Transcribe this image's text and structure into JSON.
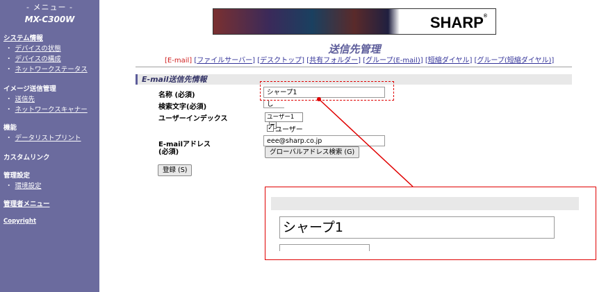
{
  "sidebar": {
    "menu_title": "- メニュー -",
    "model": "MX-C300W",
    "system_info": "システム情報",
    "system_items": [
      "デバイスの状態",
      "デバイスの構成",
      "ネットワークステータス"
    ],
    "image_send": "イメージ送信管理",
    "image_send_items": [
      "送信先",
      "ネットワークスキャナー"
    ],
    "functions": "機能",
    "function_items": [
      "データリストプリント"
    ],
    "custom_link": "カスタムリンク",
    "admin_settings": "管理設定",
    "admin_items": [
      "環境設定"
    ],
    "admin_menu": "管理者メニュー",
    "copyright": "Copyright"
  },
  "banner": {
    "logo": "SHARP",
    "reg": "®"
  },
  "page_title": "送信先管理",
  "tabs": {
    "items": [
      "E-mail",
      "ファイルサーバー",
      "デスクトップ",
      "共有フォルダー",
      "グループ(E-mail)",
      "短縮ダイヤル",
      "グループ(短縮ダイヤル)"
    ],
    "current_index": 0
  },
  "section": {
    "title": "E-mail送信先情報"
  },
  "form": {
    "name_label": "名称 (必須)",
    "name_value": "シャープ1",
    "search_label": "検索文字(必須)",
    "search_value": "し",
    "user_index_label": "ユーザーインデックス",
    "user_index_value": "ユーザー1",
    "user_checkbox_label": "ユーザー",
    "user_checkbox_checked": true,
    "email_label_1": "E-mailアドレス",
    "email_label_2": "(必須)",
    "email_value": "eee@sharp.co.jp",
    "global_search_button": "グローバルアドレス検索 (G)",
    "register_button": "登録 (S)"
  },
  "zoom": {
    "name_value": "シャープ1"
  },
  "colors": {
    "sidebar": "#6b6b9e",
    "accent": "#5c5c9a",
    "highlight": "#e00000",
    "link": "#333399"
  }
}
